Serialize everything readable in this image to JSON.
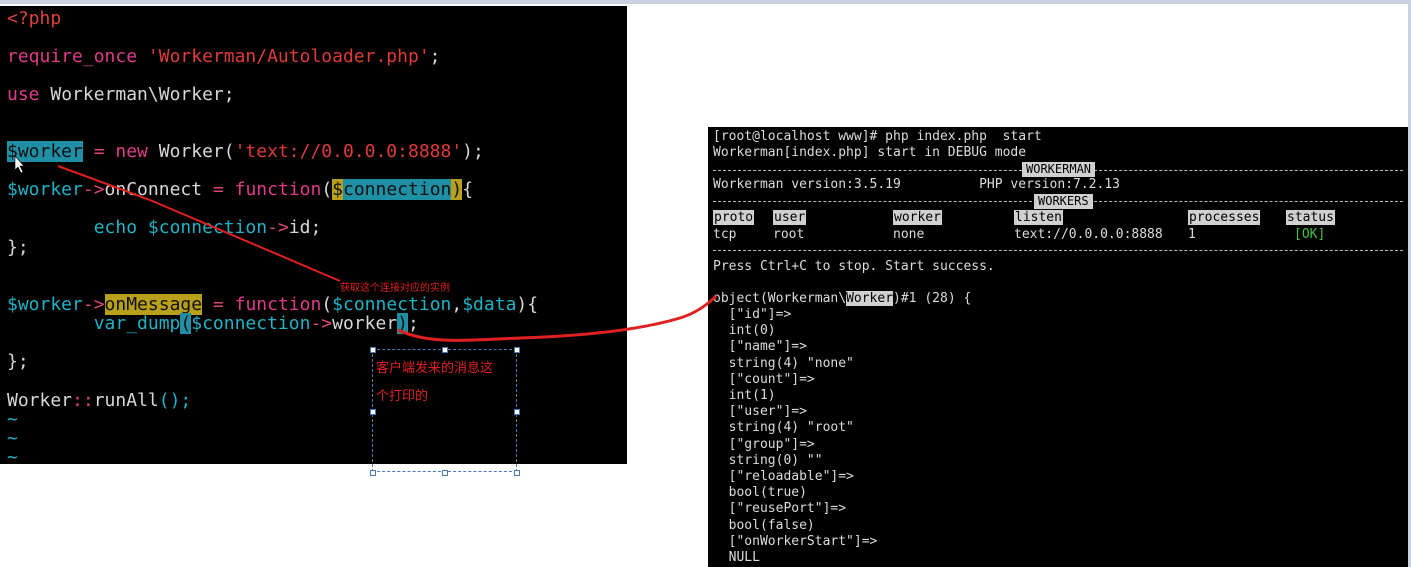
{
  "editor": {
    "lines": [
      {
        "segments": [
          {
            "t": "<?php",
            "c": "c-php"
          }
        ]
      },
      {
        "segments": [
          {
            "t": "require_once ",
            "c": "c-kw"
          },
          {
            "t": "'Workerman/Autoloader.php'",
            "c": "c-str"
          },
          {
            "t": ";",
            "c": "c-plain"
          }
        ]
      },
      {
        "segments": [
          {
            "t": "use ",
            "c": "c-kw"
          },
          {
            "t": "Workerman\\Worker;",
            "c": "c-plain"
          }
        ]
      },
      {
        "segments": [
          {
            "t": "$worker",
            "c": "hl-teal"
          },
          {
            "t": " = ",
            "c": "c-op"
          },
          {
            "t": "new ",
            "c": "c-kw"
          },
          {
            "t": "Worker(",
            "c": "c-plain"
          },
          {
            "t": "'text://0.0.0.0:8888'",
            "c": "c-str"
          },
          {
            "t": ");",
            "c": "c-plain"
          }
        ]
      },
      {
        "segments": [
          {
            "t": "$worker",
            "c": "c-var"
          },
          {
            "t": "->",
            "c": "c-op"
          },
          {
            "t": "onConnect",
            "c": "c-plain"
          },
          {
            "t": " = ",
            "c": "c-op"
          },
          {
            "t": "function",
            "c": "c-kw"
          },
          {
            "t": "(",
            "c": "c-plain"
          },
          {
            "t": "$",
            "c": "hl-yel"
          },
          {
            "t": "connection",
            "c": "hl-teal"
          },
          {
            "t": ")",
            "c": "hl-yel"
          },
          {
            "t": "{",
            "c": "c-plain"
          }
        ]
      },
      {
        "segments": [
          {
            "t": "        echo ",
            "c": "c-var"
          },
          {
            "t": "$connection",
            "c": "c-var"
          },
          {
            "t": "->",
            "c": "c-op"
          },
          {
            "t": "id;",
            "c": "c-plain"
          }
        ]
      },
      {
        "segments": [
          {
            "t": "};",
            "c": "c-plain"
          }
        ]
      },
      {
        "segments": [
          {
            "t": "$worker",
            "c": "c-var"
          },
          {
            "t": "->",
            "c": "c-op"
          },
          {
            "t": "onMessage",
            "c": "hl-yel"
          },
          {
            "t": " = ",
            "c": "c-op"
          },
          {
            "t": "function",
            "c": "c-kw"
          },
          {
            "t": "(",
            "c": "c-plain"
          },
          {
            "t": "$connection",
            "c": "c-var"
          },
          {
            "t": ",",
            "c": "c-plain"
          },
          {
            "t": "$data",
            "c": "c-var"
          },
          {
            "t": "){",
            "c": "c-plain"
          }
        ]
      },
      {
        "segments": [
          {
            "t": "        var_dump",
            "c": "c-var"
          },
          {
            "t": "(",
            "c": "hl-teal"
          },
          {
            "t": "$connection",
            "c": "c-var"
          },
          {
            "t": "->",
            "c": "c-op"
          },
          {
            "t": "worker",
            "c": "c-plain"
          },
          {
            "t": ")",
            "c": "hl-teal"
          },
          {
            "t": ";",
            "c": "c-plain"
          }
        ]
      },
      {
        "segments": [
          {
            "t": "};",
            "c": "c-plain"
          }
        ]
      },
      {
        "segments": [
          {
            "t": "Worker",
            "c": "c-plain"
          },
          {
            "t": "::",
            "c": "c-op"
          },
          {
            "t": "runAll",
            "c": "c-plain"
          },
          {
            "t": "();",
            "c": "c-var"
          }
        ]
      },
      {
        "segments": [
          {
            "t": "~",
            "c": "c-tilde"
          }
        ]
      },
      {
        "segments": [
          {
            "t": "~",
            "c": "c-tilde"
          }
        ]
      },
      {
        "segments": [
          {
            "t": "~",
            "c": "c-tilde"
          }
        ]
      }
    ]
  },
  "annotations": {
    "small_note": "获取这个连接对应的实例",
    "box_line1": "客户端发来的消息这",
    "box_line2": "个打印的"
  },
  "terminal": {
    "cmd": "[root@localhost www]# php index.php  start",
    "mode": "Workerman[index.php] start in DEBUG mode",
    "banner_workerman": "WORKERMAN",
    "versions": "Workerman version:3.5.19          PHP version:7.2.13",
    "banner_workers": "WORKERS",
    "headers": [
      "proto",
      "user",
      "worker",
      "listen",
      "processes",
      "status"
    ],
    "row": [
      "tcp",
      "root",
      "none",
      "text://0.0.0.0:8888",
      "1",
      "[OK]"
    ],
    "press": "Press Ctrl+C to stop. Start success.",
    "obj_prefix": "object(Workerman\\",
    "obj_hl": "Worker",
    "obj_suffix": ")#1 (28) {",
    "dump": [
      "  [\"id\"]=>",
      "  int(0)",
      "  [\"name\"]=>",
      "  string(4) \"none\"",
      "  [\"count\"]=>",
      "  int(1)",
      "  [\"user\"]=>",
      "  string(4) \"root\"",
      "  [\"group\"]=>",
      "  string(0) \"\"",
      "  [\"reloadable\"]=>",
      "  bool(true)",
      "  [\"reusePort\"]=>",
      "  bool(false)",
      "  [\"onWorkerStart\"]=>",
      "  NULL"
    ]
  },
  "colors": {
    "annotation_red": "#e02020",
    "teal": "#1fb3c7",
    "magenta": "#e03a8a"
  }
}
